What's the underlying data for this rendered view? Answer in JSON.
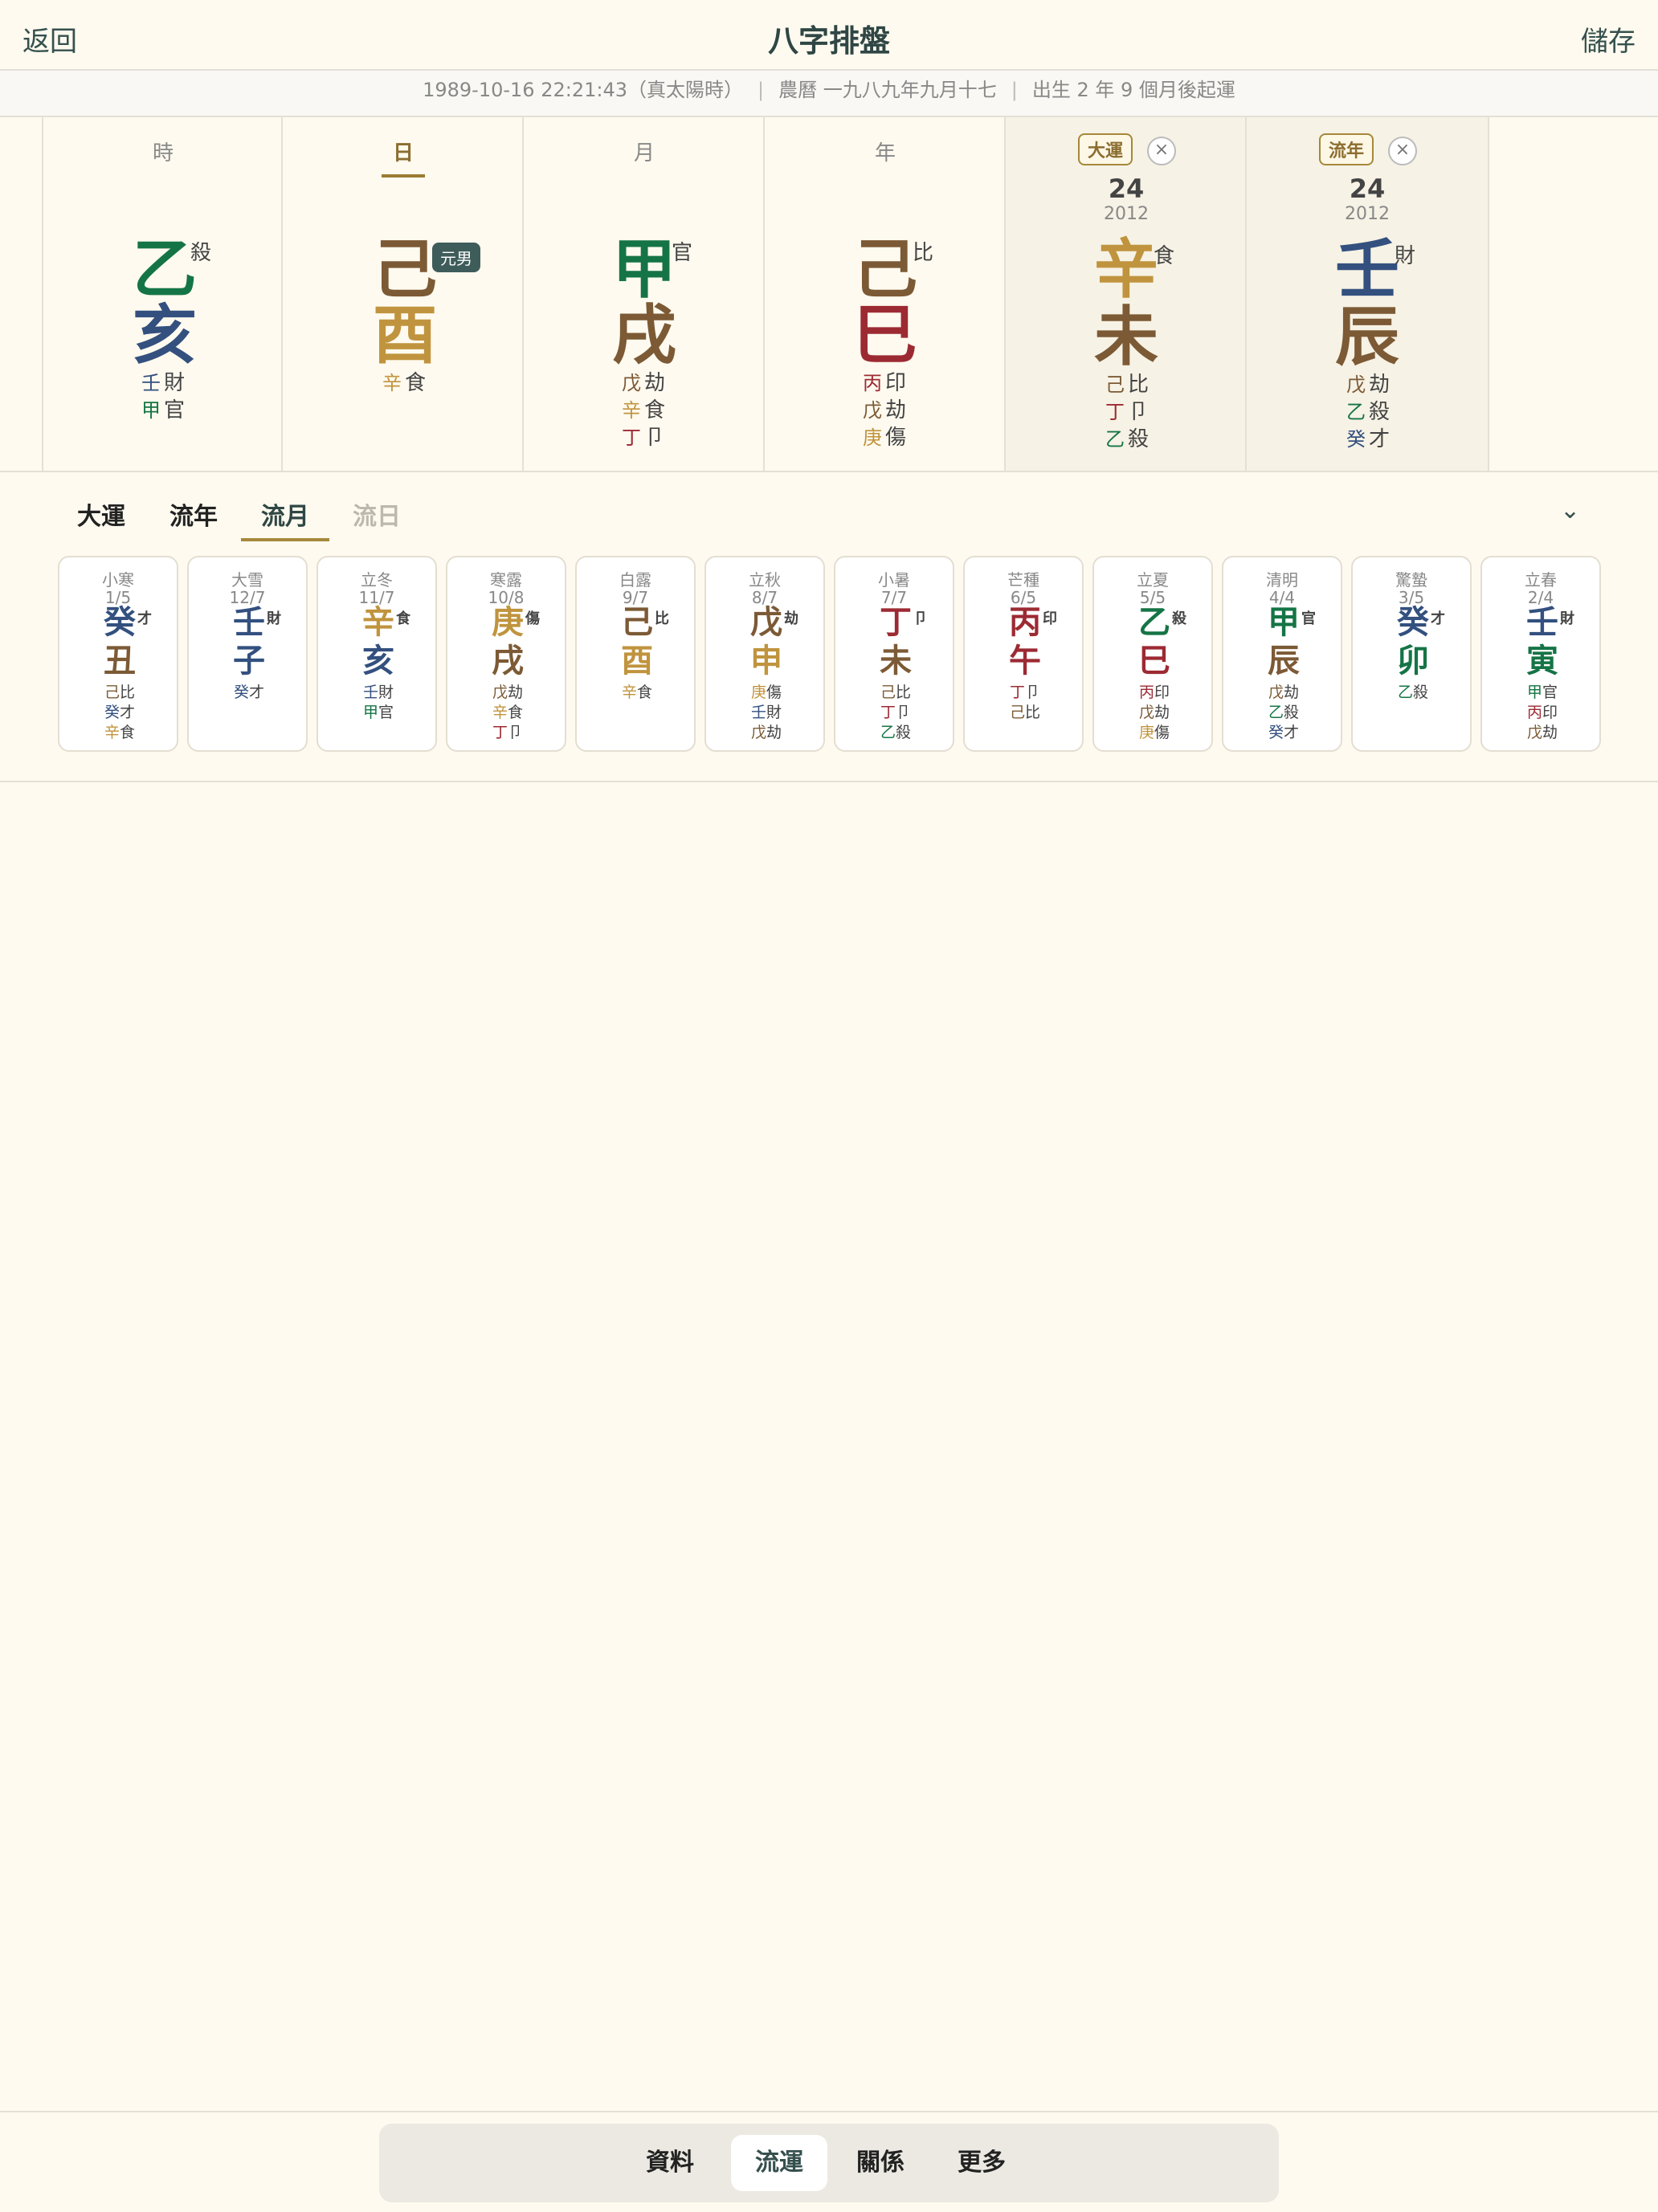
{
  "header": {
    "back_label": "返回",
    "title": "八字排盤",
    "save_label": "儲存"
  },
  "info": {
    "solar": "1989-10-16 22:21:43（真太陽時）",
    "lunar": "農曆 一九八九年九月十七",
    "luck_start": "出生 2 年 9 個月後起運"
  },
  "pillars": [
    {
      "label": "時",
      "stem": "乙",
      "stem_ten": "殺",
      "branch": "亥",
      "hidden": [
        {
          "s": "壬",
          "g": "財"
        },
        {
          "s": "甲",
          "g": "官"
        }
      ]
    },
    {
      "label": "日",
      "stem": "己",
      "gender_tag": "元男",
      "branch": "酉",
      "hidden": [
        {
          "s": "辛",
          "g": "食"
        }
      ]
    },
    {
      "label": "月",
      "stem": "甲",
      "stem_ten": "官",
      "branch": "戌",
      "hidden": [
        {
          "s": "戊",
          "g": "劫"
        },
        {
          "s": "辛",
          "g": "食"
        },
        {
          "s": "丁",
          "g": "卩"
        }
      ]
    },
    {
      "label": "年",
      "stem": "己",
      "stem_ten": "比",
      "branch": "巳",
      "hidden": [
        {
          "s": "丙",
          "g": "印"
        },
        {
          "s": "戊",
          "g": "劫"
        },
        {
          "s": "庚",
          "g": "傷"
        }
      ]
    },
    {
      "label": "大運",
      "age": "24",
      "year": "2012",
      "stem": "辛",
      "stem_ten": "食",
      "branch": "未",
      "hidden": [
        {
          "s": "己",
          "g": "比"
        },
        {
          "s": "丁",
          "g": "卩"
        },
        {
          "s": "乙",
          "g": "殺"
        }
      ]
    },
    {
      "label": "流年",
      "age": "24",
      "year": "2012",
      "stem": "壬",
      "stem_ten": "財",
      "branch": "辰",
      "hidden": [
        {
          "s": "戊",
          "g": "劫"
        },
        {
          "s": "乙",
          "g": "殺"
        },
        {
          "s": "癸",
          "g": "才"
        }
      ]
    }
  ],
  "close_symbol": "×",
  "tabs": [
    "大運",
    "流年",
    "流月",
    "流日"
  ],
  "active_tab": "流月",
  "chevron": "⌄",
  "months": [
    {
      "term": "小寒",
      "date": "1/5",
      "stem": "癸",
      "ten": "才",
      "branch": "丑",
      "hidden": [
        {
          "s": "己",
          "g": "比"
        },
        {
          "s": "癸",
          "g": "才"
        },
        {
          "s": "辛",
          "g": "食"
        }
      ]
    },
    {
      "term": "大雪",
      "date": "12/7",
      "stem": "壬",
      "ten": "財",
      "branch": "子",
      "hidden": [
        {
          "s": "癸",
          "g": "才"
        }
      ]
    },
    {
      "term": "立冬",
      "date": "11/7",
      "stem": "辛",
      "ten": "食",
      "branch": "亥",
      "hidden": [
        {
          "s": "壬",
          "g": "財"
        },
        {
          "s": "甲",
          "g": "官"
        }
      ]
    },
    {
      "term": "寒露",
      "date": "10/8",
      "stem": "庚",
      "ten": "傷",
      "branch": "戌",
      "hidden": [
        {
          "s": "戊",
          "g": "劫"
        },
        {
          "s": "辛",
          "g": "食"
        },
        {
          "s": "丁",
          "g": "卩"
        }
      ]
    },
    {
      "term": "白露",
      "date": "9/7",
      "stem": "己",
      "ten": "比",
      "branch": "酉",
      "hidden": [
        {
          "s": "辛",
          "g": "食"
        }
      ]
    },
    {
      "term": "立秋",
      "date": "8/7",
      "stem": "戊",
      "ten": "劫",
      "branch": "申",
      "hidden": [
        {
          "s": "庚",
          "g": "傷"
        },
        {
          "s": "壬",
          "g": "財"
        },
        {
          "s": "戊",
          "g": "劫"
        }
      ]
    },
    {
      "term": "小暑",
      "date": "7/7",
      "stem": "丁",
      "ten": "卩",
      "branch": "未",
      "hidden": [
        {
          "s": "己",
          "g": "比"
        },
        {
          "s": "丁",
          "g": "卩"
        },
        {
          "s": "乙",
          "g": "殺"
        }
      ]
    },
    {
      "term": "芒種",
      "date": "6/5",
      "stem": "丙",
      "ten": "印",
      "branch": "午",
      "hidden": [
        {
          "s": "丁",
          "g": "卩"
        },
        {
          "s": "己",
          "g": "比"
        }
      ]
    },
    {
      "term": "立夏",
      "date": "5/5",
      "stem": "乙",
      "ten": "殺",
      "branch": "巳",
      "hidden": [
        {
          "s": "丙",
          "g": "印"
        },
        {
          "s": "戊",
          "g": "劫"
        },
        {
          "s": "庚",
          "g": "傷"
        }
      ]
    },
    {
      "term": "清明",
      "date": "4/4",
      "stem": "甲",
      "ten": "官",
      "branch": "辰",
      "hidden": [
        {
          "s": "戊",
          "g": "劫"
        },
        {
          "s": "乙",
          "g": "殺"
        },
        {
          "s": "癸",
          "g": "才"
        }
      ]
    },
    {
      "term": "驚蟄",
      "date": "3/5",
      "stem": "癸",
      "ten": "才",
      "branch": "卯",
      "hidden": [
        {
          "s": "乙",
          "g": "殺"
        }
      ]
    },
    {
      "term": "立春",
      "date": "2/4",
      "stem": "壬",
      "ten": "財",
      "branch": "寅",
      "hidden": [
        {
          "s": "甲",
          "g": "官"
        },
        {
          "s": "丙",
          "g": "印"
        },
        {
          "s": "戊",
          "g": "劫"
        }
      ]
    }
  ],
  "bottom_nav": [
    "資料",
    "流運",
    "關係",
    "更多"
  ],
  "active_nav": "流運",
  "element_colors": {
    "wood": "#157445",
    "fire": "#9c2a33",
    "earth": "#7c5a35",
    "metal": "#c0943e",
    "water": "#33507f"
  },
  "accent_color": "#35504e"
}
